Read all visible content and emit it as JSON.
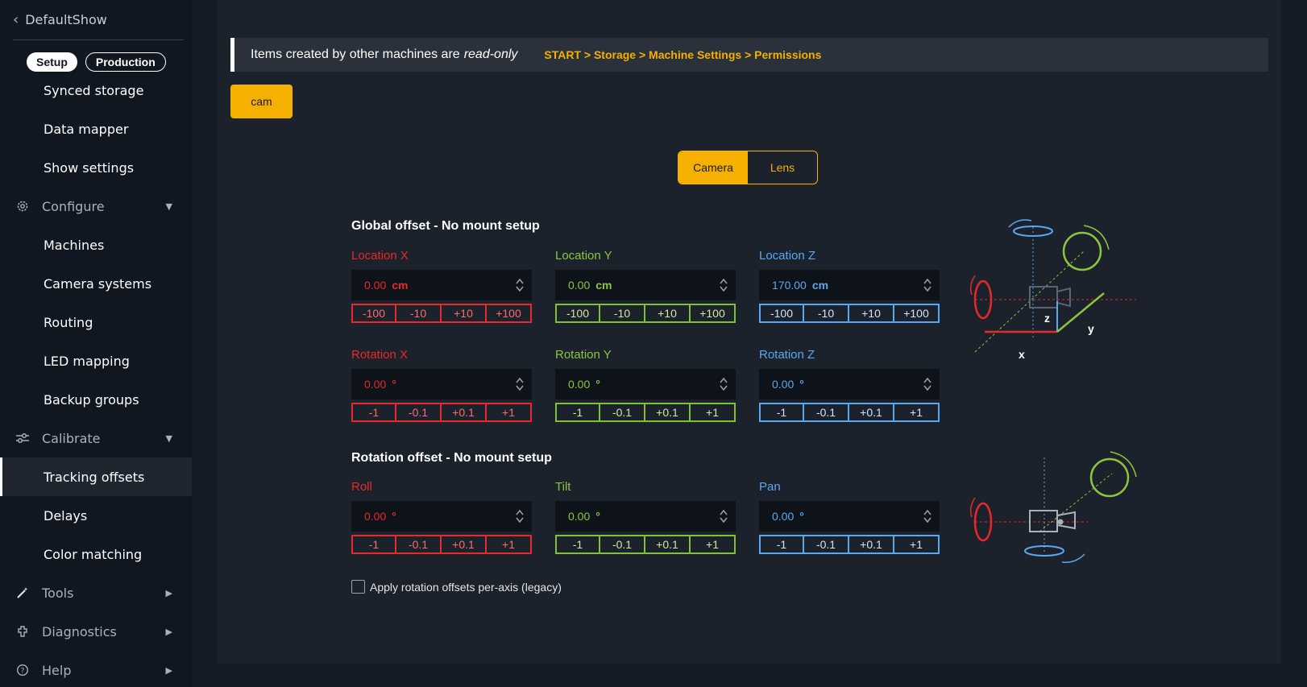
{
  "sidebar": {
    "back_label": "DefaultShow",
    "modes": [
      "Setup",
      "Production"
    ],
    "items": [
      {
        "label": "Synced storage"
      },
      {
        "label": "Data mapper"
      },
      {
        "label": "Show settings"
      },
      {
        "label": "Configure"
      },
      {
        "label": "Machines"
      },
      {
        "label": "Camera systems"
      },
      {
        "label": "Routing"
      },
      {
        "label": "LED mapping"
      },
      {
        "label": "Backup groups"
      },
      {
        "label": "Calibrate"
      },
      {
        "label": "Tracking offsets"
      },
      {
        "label": "Delays"
      },
      {
        "label": "Color matching"
      },
      {
        "label": "Tools"
      },
      {
        "label": "Diagnostics"
      },
      {
        "label": "Help"
      }
    ]
  },
  "banner": {
    "text": "Items created by other machines are",
    "emphasis": "read-only",
    "breadcrumb": "START > Storage > Machine Settings > Permissions"
  },
  "cam_button": "cam",
  "tabs": [
    "Camera",
    "Lens"
  ],
  "global": {
    "title": "Global offset - No mount setup",
    "fields": [
      {
        "label": "Location X",
        "value": "0.00",
        "unit": "cm",
        "buttons": [
          "-100",
          "-10",
          "+10",
          "+100"
        ]
      },
      {
        "label": "Location Y",
        "value": "0.00",
        "unit": "cm",
        "buttons": [
          "-100",
          "-10",
          "+10",
          "+100"
        ]
      },
      {
        "label": "Location Z",
        "value": "170.00",
        "unit": "cm",
        "buttons": [
          "-100",
          "-10",
          "+10",
          "+100"
        ]
      },
      {
        "label": "Rotation X",
        "value": "0.00",
        "unit": "°",
        "buttons": [
          "-1",
          "-0.1",
          "+0.1",
          "+1"
        ]
      },
      {
        "label": "Rotation Y",
        "value": "0.00",
        "unit": "°",
        "buttons": [
          "-1",
          "-0.1",
          "+0.1",
          "+1"
        ]
      },
      {
        "label": "Rotation Z",
        "value": "0.00",
        "unit": "°",
        "buttons": [
          "-1",
          "-0.1",
          "+0.1",
          "+1"
        ]
      }
    ]
  },
  "rotation": {
    "title": "Rotation offset - No mount setup",
    "fields": [
      {
        "label": "Roll",
        "value": "0.00",
        "unit": "°",
        "buttons": [
          "-1",
          "-0.1",
          "+0.1",
          "+1"
        ]
      },
      {
        "label": "Tilt",
        "value": "0.00",
        "unit": "°",
        "buttons": [
          "-1",
          "-0.1",
          "+0.1",
          "+1"
        ]
      },
      {
        "label": "Pan",
        "value": "0.00",
        "unit": "°",
        "buttons": [
          "-1",
          "-0.1",
          "+0.1",
          "+1"
        ]
      }
    ]
  },
  "axis_labels": {
    "x": "x",
    "y": "y",
    "z": "z"
  },
  "legacy_checkbox": "Apply rotation offsets per-axis (legacy)",
  "colors": {
    "accent": "#f5b000",
    "x_axis": "#e8282a",
    "y_axis": "#8cc63f",
    "z_axis": "#5aa8f0"
  }
}
